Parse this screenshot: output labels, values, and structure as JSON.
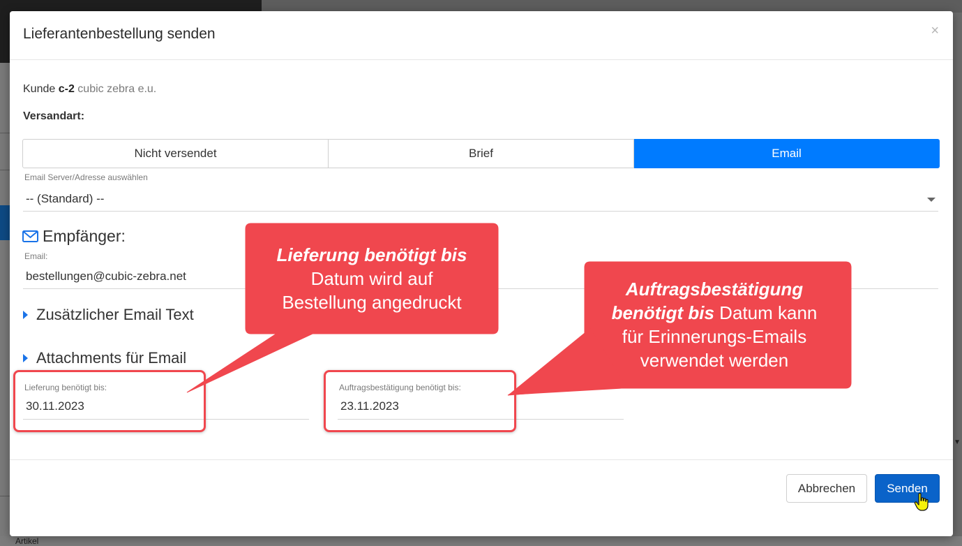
{
  "background": {
    "bottom_text": "Artikel"
  },
  "modal": {
    "title": "Lieferantenbestellung senden",
    "close_symbol": "×",
    "customer": {
      "prefix": "Kunde",
      "id": "c-2",
      "name": "cubic zebra e.u."
    },
    "versandart_label": "Versandart:",
    "shipping_options": [
      {
        "label": "Nicht versendet",
        "active": false
      },
      {
        "label": "Brief",
        "active": false
      },
      {
        "label": "Email",
        "active": true
      }
    ],
    "email_server": {
      "label": "Email Server/Adresse auswählen",
      "value": "-- (Standard) --"
    },
    "recipient": {
      "heading": "Empfänger:",
      "icon": "envelope-icon",
      "email_label": "Email:",
      "email_value": "bestellungen@cubic-zebra.net"
    },
    "sections": {
      "extra_text": "Zusätzlicher Email Text",
      "attachments": "Attachments für Email"
    },
    "dates": {
      "delivery_label": "Lieferung benötigt bis:",
      "delivery_value": "30.11.2023",
      "confirmation_label": "Auftragsbestätigung benötigt bis:",
      "confirmation_value": "23.11.2023"
    },
    "footer": {
      "cancel_label": "Abbrechen",
      "send_label": "Senden"
    }
  },
  "callouts": {
    "left": {
      "bold": "Lieferung benötigt bis",
      "line2": "Datum wird auf",
      "line3": "Bestellung angedruckt"
    },
    "right": {
      "bold1": "Auftragsbestätigung",
      "bold2": "benötigt bis",
      "rest2": " Datum kann",
      "line3": "für Erinnerungs-Emails",
      "line4": "verwendet werden"
    },
    "color": "#f0474e"
  },
  "colors": {
    "primary": "#007bff",
    "send_button": "#0a63c9",
    "accent_triangle": "#1a73e8"
  }
}
